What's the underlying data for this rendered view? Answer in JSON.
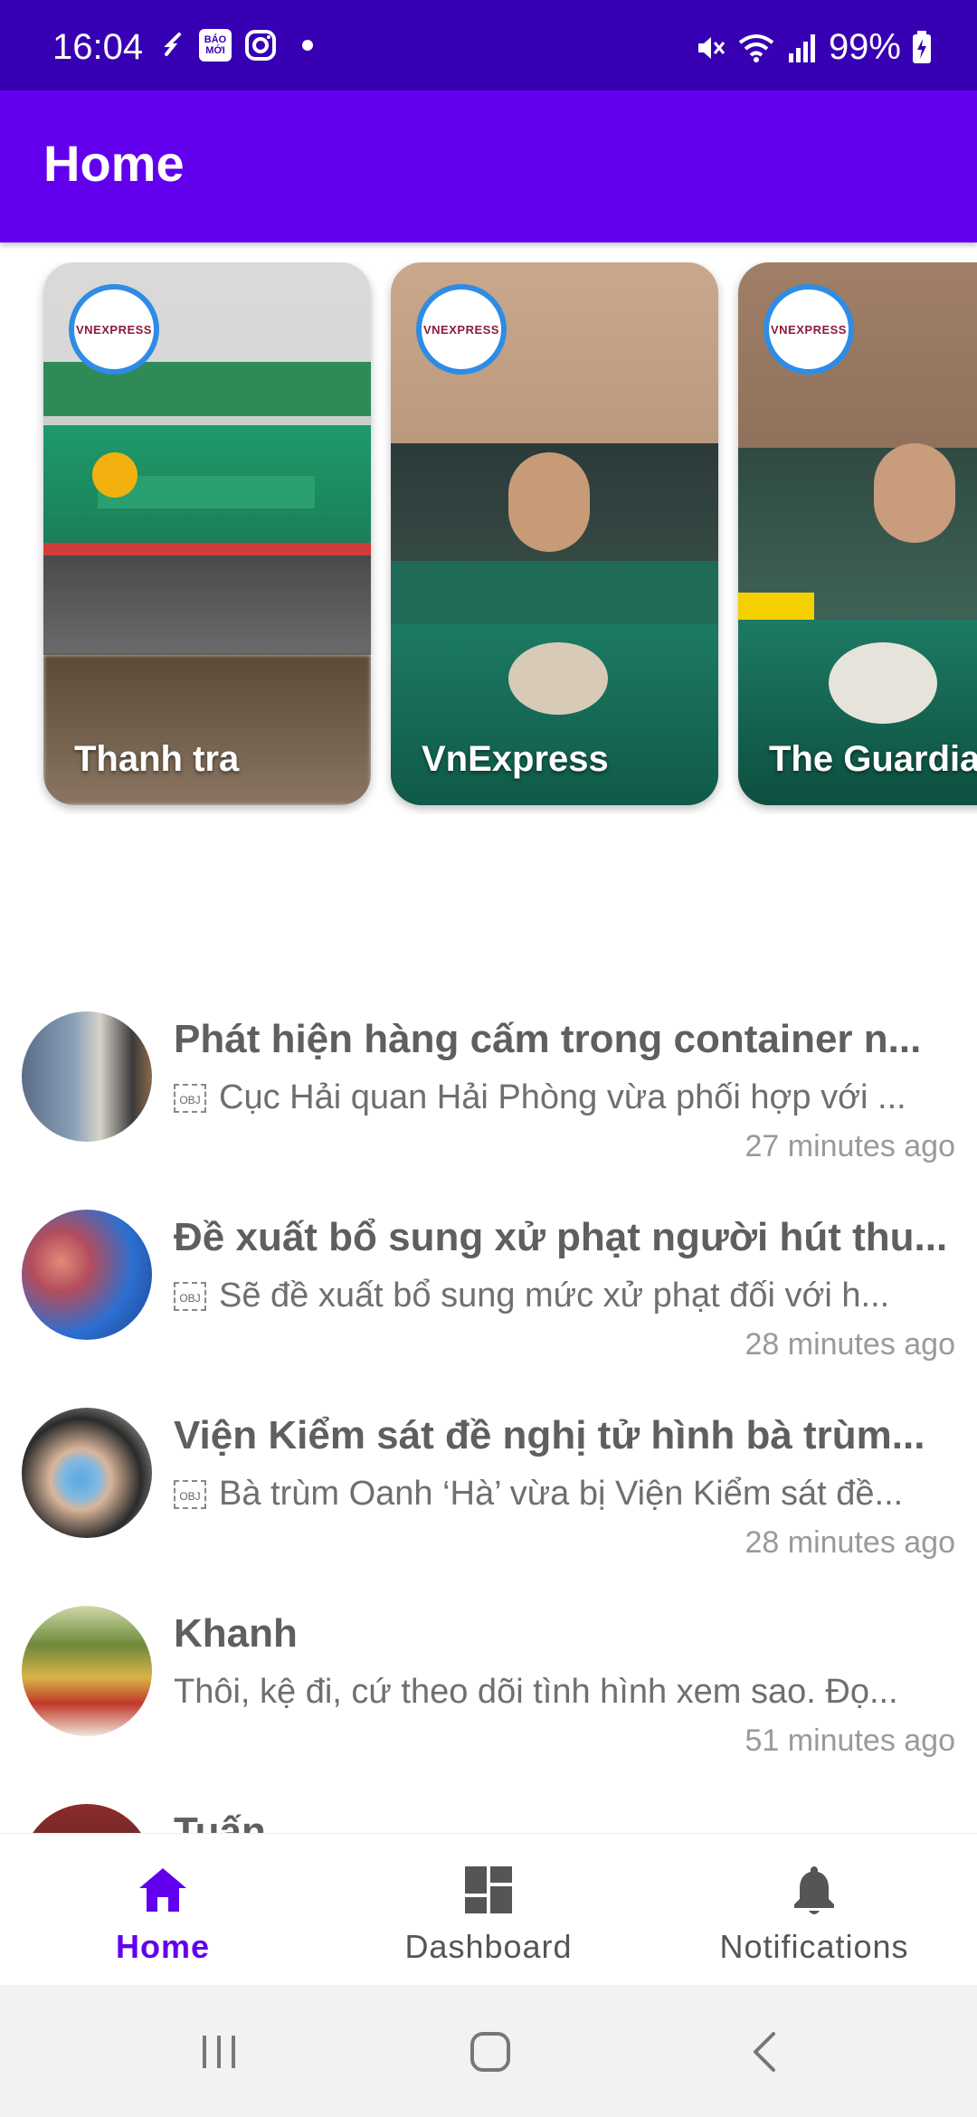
{
  "status_bar": {
    "time": "16:04",
    "badge_line1": "BÁO",
    "badge_line2": "MỚI",
    "battery": "99%",
    "icons": [
      "nfc-icon",
      "baomoi-icon",
      "instagram-icon",
      "dot-icon",
      "mute-icon",
      "wifi-icon",
      "signal-icon",
      "battery-charging-icon"
    ]
  },
  "app_bar": {
    "title": "Home"
  },
  "stories": [
    {
      "label": "Thanh tra",
      "logo": "VNEXPRESS"
    },
    {
      "label": "VnExpress",
      "logo": "VNEXPRESS"
    },
    {
      "label": "The Guardian",
      "logo": "VNEXPRESS"
    }
  ],
  "feed": [
    {
      "title": "Phát hiện hàng cấm trong container n...",
      "snippet": "Cục Hải quan Hải Phòng vừa phối hợp với ...",
      "has_obj": true,
      "obj_text": "OBJ",
      "time": "27 minutes ago"
    },
    {
      "title": "Đề xuất bổ sung xử phạt người hút thu...",
      "snippet": "Sẽ đề xuất bổ sung mức xử phạt đối với h...",
      "has_obj": true,
      "obj_text": "OBJ",
      "time": "28 minutes ago"
    },
    {
      "title": "Viện Kiểm sát đề nghị tử hình bà trùm...",
      "snippet": "Bà trùm Oanh ‘Hà’ vừa bị Viện Kiểm sát đề...",
      "has_obj": true,
      "obj_text": "OBJ",
      "time": "28 minutes ago"
    },
    {
      "title": "Khanh",
      "snippet": "Thôi, kệ đi, cứ theo dõi tình hình xem sao.  Đọ...",
      "has_obj": false,
      "time": "51 minutes ago"
    },
    {
      "title": "Tuấn",
      "snippet": "",
      "has_obj": false,
      "time": ""
    }
  ],
  "bottom_nav": {
    "items": [
      {
        "label": "Home",
        "icon": "home-icon",
        "active": true
      },
      {
        "label": "Dashboard",
        "icon": "dashboard-icon",
        "active": false
      },
      {
        "label": "Notifications",
        "icon": "bell-icon",
        "active": false
      }
    ],
    "active_color": "#6200ee",
    "inactive_color": "#555555"
  },
  "colors": {
    "primary": "#6200ee",
    "primary_dark": "#3700b3",
    "story_ring": "#2f8ce5"
  }
}
